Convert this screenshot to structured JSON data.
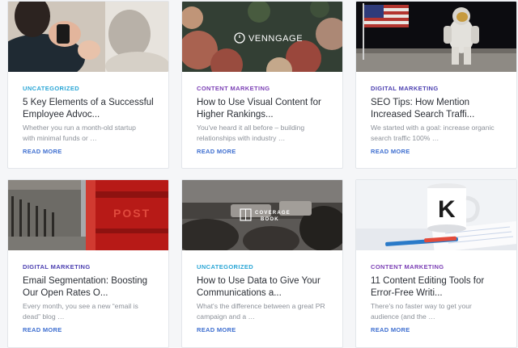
{
  "cards": [
    {
      "category": "UNCATEGORIZED",
      "category_color": "#2aa6d6",
      "title_line1": "5 Key Elements of a Successful",
      "title_line2": "Employee Advoc...",
      "excerpt_line1": "Whether you run a month-old startup",
      "excerpt_line2": "with minimal funds or …",
      "read_more": "READ MORE",
      "image": "people-with-phones-photo"
    },
    {
      "category": "CONTENT MARKETING",
      "category_color": "#7b3fb5",
      "title_line1": "How to Use Visual Content for",
      "title_line2": "Higher Rankings...",
      "excerpt_line1": "You've heard it all before – building",
      "excerpt_line2": "relationships with industry …",
      "read_more": "READ MORE",
      "image": "flowers-venngage-photo",
      "image_text": "VENNGAGE"
    },
    {
      "category": "DIGITAL MARKETING",
      "category_color": "#4b3fb0",
      "title_line1": "SEO Tips: How Mention",
      "title_line2": "Increased Search Traffi...",
      "excerpt_line1": "We started with a goal: increase organic",
      "excerpt_line2": "search traffic 100% …",
      "read_more": "READ MORE",
      "image": "astronaut-flag-photo"
    },
    {
      "category": "DIGITAL MARKETING",
      "category_color": "#4b3fb0",
      "title_line1": "Email Segmentation: Boosting",
      "title_line2": "Our Open Rates O...",
      "excerpt_line1": "Every month, you see a new “email is",
      "excerpt_line2": "dead” blog …",
      "read_more": "READ MORE",
      "image": "red-postbox-photo",
      "image_text": "POST"
    },
    {
      "category": "UNCATEGORIZED",
      "category_color": "#2aa6d6",
      "title_line1": "How to Use Data to Give Your",
      "title_line2": "Communications a...",
      "excerpt_line1": "What's the difference between a great PR",
      "excerpt_line2": "campaign and a …",
      "read_more": "READ MORE",
      "image": "coveragebook-photo",
      "image_text_1": "COVERAGE",
      "image_text_2": "BOOK"
    },
    {
      "category": "CONTENT MARKETING",
      "category_color": "#7b3fb5",
      "title_line1": "11 Content Editing Tools for",
      "title_line2": "Error-Free Writi...",
      "excerpt_line1": "There's no faster way to get your",
      "excerpt_line2": "audience (and the …",
      "read_more": "READ MORE",
      "image": "desk-mug-photo",
      "image_text": "K"
    }
  ]
}
